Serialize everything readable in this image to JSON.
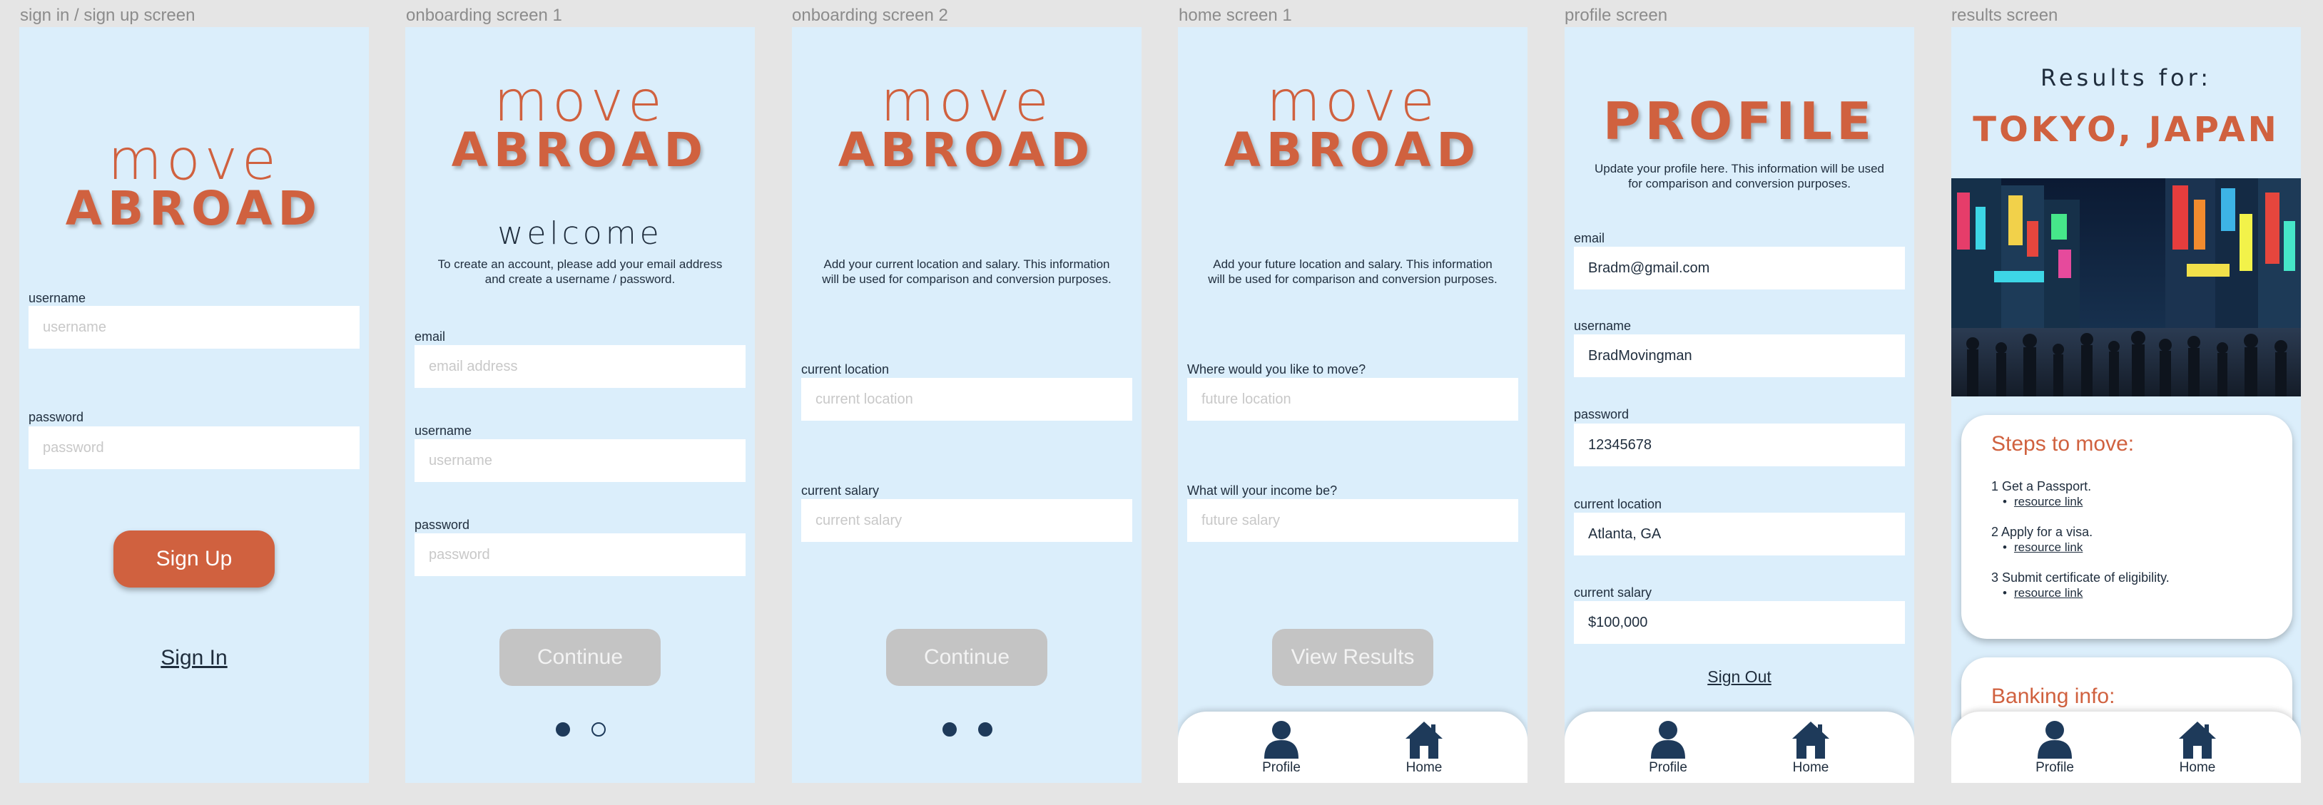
{
  "labels": {
    "s1": "sign in / sign up screen",
    "s2": "onboarding screen 1",
    "s3": "onboarding screen 2",
    "s4": "home screen 1",
    "s5": "profile screen",
    "s6": "results screen"
  },
  "logo": {
    "move": "move",
    "abroad": "Abroad"
  },
  "signin": {
    "username_label": "username",
    "username_placeholder": "username",
    "password_label": "password",
    "password_placeholder": "password",
    "signup_button": "Sign Up",
    "signin_link": "Sign In"
  },
  "onboarding1": {
    "welcome": "welcome",
    "description": "To create an account, please add your email address and create a username / password.",
    "email_label": "email",
    "email_placeholder": "email address",
    "username_label": "username",
    "username_placeholder": "username",
    "password_label": "password",
    "password_placeholder": "password",
    "continue_button": "Continue"
  },
  "onboarding2": {
    "description": "Add your current location and salary. This information will be used for comparison and conversion purposes.",
    "location_label": "current location",
    "location_placeholder": "current location",
    "salary_label": "current salary",
    "salary_placeholder": "current salary",
    "continue_button": "Continue"
  },
  "home": {
    "description": "Add your future location and salary. This information will be used for comparison and conversion purposes.",
    "location_label": "Where would you like to move?",
    "location_placeholder": "future location",
    "income_label": "What will your income be?",
    "income_placeholder": "future salary",
    "results_button": "View Results"
  },
  "profile": {
    "title": "Profile",
    "description": "Update your profile here. This information will be used for comparison and conversion purposes.",
    "email_label": "email",
    "email_value": "Bradm@gmail.com",
    "username_label": "username",
    "username_value": "BradMovingman",
    "password_label": "password",
    "password_value": "12345678",
    "location_label": "current location",
    "location_value": "Atlanta, GA",
    "salary_label": "current salary",
    "salary_value": "$100,000",
    "signout_link": "Sign Out"
  },
  "results": {
    "results_for": "Results for:",
    "city": "Tokyo, Japan",
    "steps_title": "Steps to move:",
    "steps": [
      {
        "text": "1 Get a Passport.",
        "link": "resource link"
      },
      {
        "text": "2 Apply for a visa.",
        "link": "resource link"
      },
      {
        "text": "3 Submit certificate of eligibility.",
        "link": "resource link"
      }
    ],
    "banking_title": "Banking info:"
  },
  "tabbar": {
    "profile": "Profile",
    "home": "Home"
  },
  "colors": {
    "accent": "#d0613f",
    "frame_bg": "#dbeefb",
    "navy": "#1e3a5a",
    "disabled": "#c4c4c4"
  },
  "icons": {
    "profile": "person-icon",
    "home": "house-icon"
  }
}
